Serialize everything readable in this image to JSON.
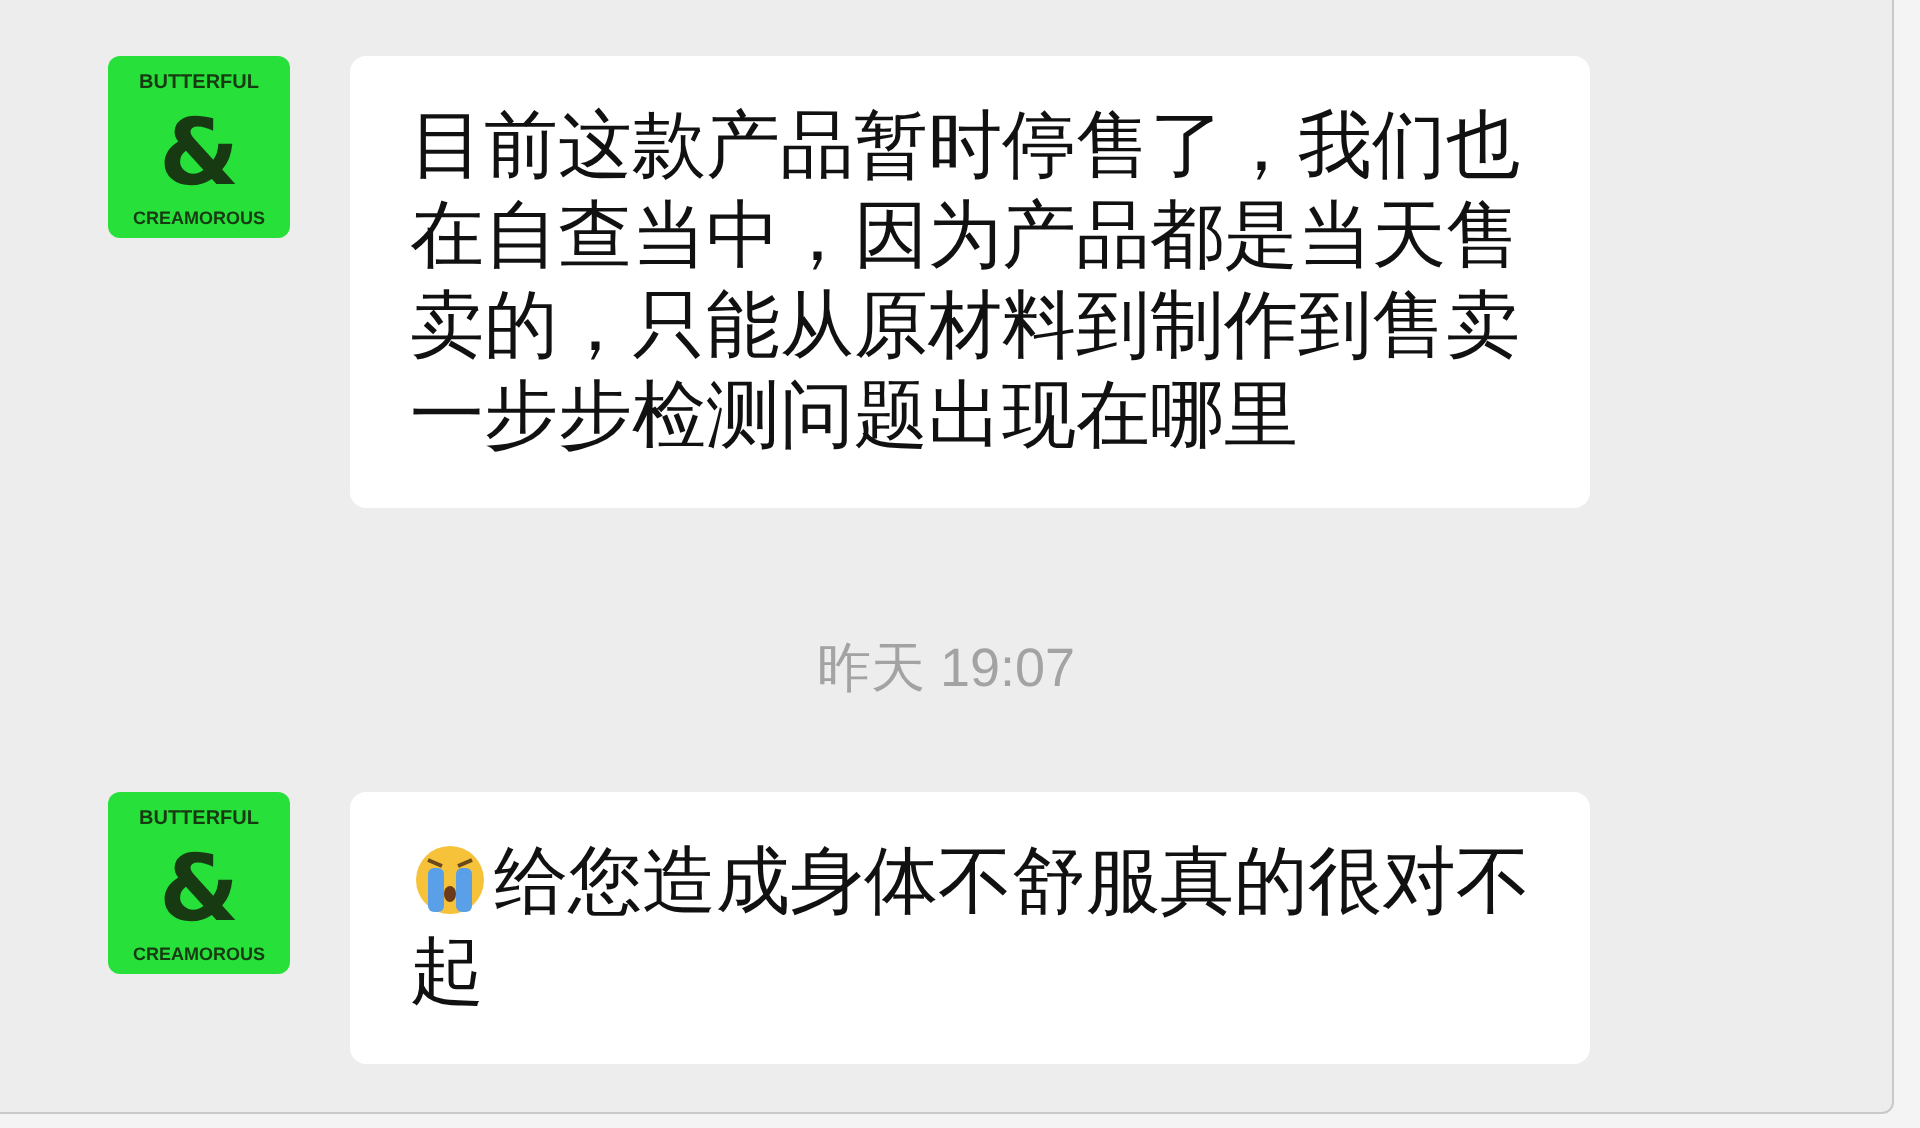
{
  "chat": [
    {
      "kind": "text",
      "avatar": {
        "top": "BUTTERFUL",
        "mark": "&",
        "bottom": "CREAMOROUS"
      },
      "text": "目前这款产品暂时停售了，我们也在自查当中，因为产品都是当天售卖的，只能从原材料到制作到售卖一步步检测问题出现在哪里"
    },
    {
      "kind": "time",
      "text": "昨天 19:07"
    },
    {
      "kind": "emoji_text",
      "avatar": {
        "top": "BUTTERFUL",
        "mark": "&",
        "bottom": "CREAMOROUS"
      },
      "text": "给您造成身体不舒服真的很对不起"
    }
  ]
}
